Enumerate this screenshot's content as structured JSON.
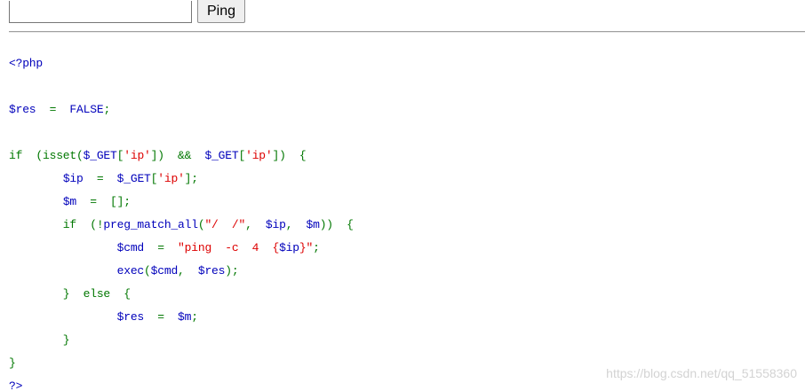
{
  "form": {
    "ip_input_value": "",
    "ping_button_label": "Ping"
  },
  "colors": {
    "default": "#0000bb",
    "keyword": "#007700",
    "string": "#dd0000"
  },
  "code": {
    "lines": [
      [
        {
          "t": "<?php",
          "c": "default"
        }
      ],
      [],
      [
        {
          "t": "$res",
          "c": "default"
        },
        {
          "t": "  =  ",
          "c": "keyword"
        },
        {
          "t": "FALSE",
          "c": "default"
        },
        {
          "t": ";",
          "c": "keyword"
        }
      ],
      [],
      [
        {
          "t": "if  (isset(",
          "c": "keyword"
        },
        {
          "t": "$_GET",
          "c": "default"
        },
        {
          "t": "[",
          "c": "keyword"
        },
        {
          "t": "'ip'",
          "c": "string"
        },
        {
          "t": "])  &&  ",
          "c": "keyword"
        },
        {
          "t": "$_GET",
          "c": "default"
        },
        {
          "t": "[",
          "c": "keyword"
        },
        {
          "t": "'ip'",
          "c": "string"
        },
        {
          "t": "])  {",
          "c": "keyword"
        }
      ],
      [
        {
          "t": "        ",
          "c": "keyword"
        },
        {
          "t": "$ip",
          "c": "default"
        },
        {
          "t": "  =  ",
          "c": "keyword"
        },
        {
          "t": "$_GET",
          "c": "default"
        },
        {
          "t": "[",
          "c": "keyword"
        },
        {
          "t": "'ip'",
          "c": "string"
        },
        {
          "t": "];",
          "c": "keyword"
        }
      ],
      [
        {
          "t": "        ",
          "c": "keyword"
        },
        {
          "t": "$m",
          "c": "default"
        },
        {
          "t": "  =  [];",
          "c": "keyword"
        }
      ],
      [
        {
          "t": "        if  (!",
          "c": "keyword"
        },
        {
          "t": "preg_match_all",
          "c": "default"
        },
        {
          "t": "(",
          "c": "keyword"
        },
        {
          "t": "\"/  /\"",
          "c": "string"
        },
        {
          "t": ",  ",
          "c": "keyword"
        },
        {
          "t": "$ip",
          "c": "default"
        },
        {
          "t": ",  ",
          "c": "keyword"
        },
        {
          "t": "$m",
          "c": "default"
        },
        {
          "t": "))  {",
          "c": "keyword"
        }
      ],
      [
        {
          "t": "                ",
          "c": "keyword"
        },
        {
          "t": "$cmd",
          "c": "default"
        },
        {
          "t": "  =  ",
          "c": "keyword"
        },
        {
          "t": "\"ping  -c  4  {",
          "c": "string"
        },
        {
          "t": "$ip",
          "c": "default"
        },
        {
          "t": "}\"",
          "c": "string"
        },
        {
          "t": ";",
          "c": "keyword"
        }
      ],
      [
        {
          "t": "                ",
          "c": "keyword"
        },
        {
          "t": "exec",
          "c": "default"
        },
        {
          "t": "(",
          "c": "keyword"
        },
        {
          "t": "$cmd",
          "c": "default"
        },
        {
          "t": ",  ",
          "c": "keyword"
        },
        {
          "t": "$res",
          "c": "default"
        },
        {
          "t": ");",
          "c": "keyword"
        }
      ],
      [
        {
          "t": "        }  else  {",
          "c": "keyword"
        }
      ],
      [
        {
          "t": "                ",
          "c": "keyword"
        },
        {
          "t": "$res",
          "c": "default"
        },
        {
          "t": "  =  ",
          "c": "keyword"
        },
        {
          "t": "$m",
          "c": "default"
        },
        {
          "t": ";",
          "c": "keyword"
        }
      ],
      [
        {
          "t": "        }",
          "c": "keyword"
        }
      ],
      [
        {
          "t": "}",
          "c": "keyword"
        }
      ],
      [
        {
          "t": "?>",
          "c": "default"
        }
      ]
    ]
  },
  "watermark": {
    "text": "https://blog.csdn.net/qq_51558360"
  }
}
